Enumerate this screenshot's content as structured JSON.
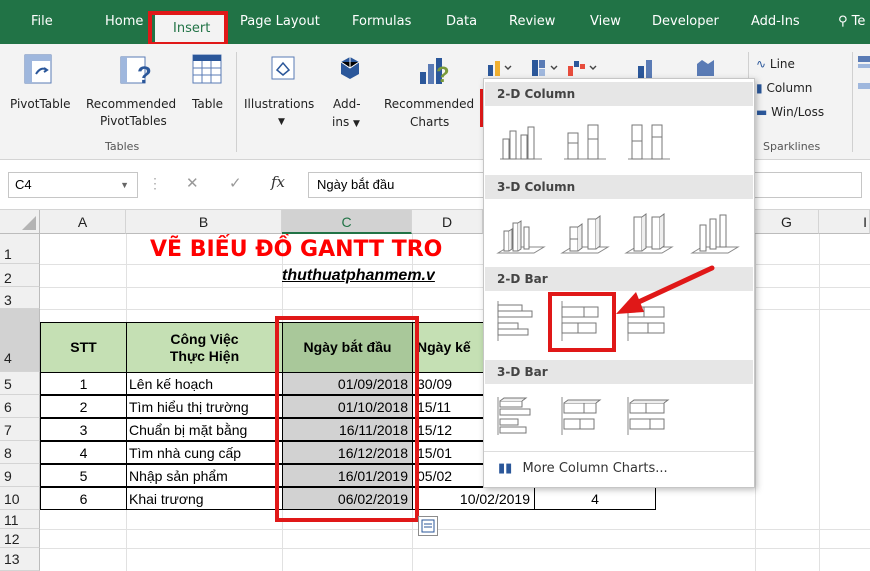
{
  "ribbon": {
    "tabs": [
      {
        "label": "File"
      },
      {
        "label": "Home"
      },
      {
        "label": "Insert"
      },
      {
        "label": "Page Layout"
      },
      {
        "label": "Formulas"
      },
      {
        "label": "Data"
      },
      {
        "label": "Review"
      },
      {
        "label": "View"
      },
      {
        "label": "Developer"
      },
      {
        "label": "Add-Ins"
      },
      {
        "label": "Te"
      }
    ],
    "groups": {
      "tables": {
        "label": "Tables",
        "pivottable": "PivotTable",
        "recommended_1": "Recommended",
        "recommended_2": "PivotTables",
        "table": "Table"
      },
      "illustrations": "Illustrations",
      "addins_1": "Add-",
      "addins_2": "ins",
      "rec_charts_1": "Recommended",
      "rec_charts_2": "Charts",
      "sparklines": {
        "label": "Sparklines",
        "line": "Line",
        "column": "Column",
        "winloss": "Win/Loss"
      }
    }
  },
  "formula_bar": {
    "cell_ref": "C4",
    "content": "Ngày bắt đầu"
  },
  "sheet": {
    "columns": [
      "A",
      "B",
      "C",
      "D",
      "G"
    ],
    "rows": [
      "1",
      "2",
      "3",
      "4",
      "5",
      "6",
      "7",
      "8",
      "9",
      "10",
      "11",
      "12",
      "13"
    ],
    "title": "VẼ BIỂU ĐỒ GANTT TRO",
    "subtitle": "thuthuatphanmem.v",
    "headers": {
      "stt": "STT",
      "task_1": "Công Việc",
      "task_2": "Thực Hiện",
      "start": "Ngày bắt đầu",
      "end": "Ngày kế"
    },
    "data": [
      {
        "stt": "1",
        "task": "Lên kế hoạch",
        "start": "01/09/2018",
        "end": "30/09",
        "dur": ""
      },
      {
        "stt": "2",
        "task": "Tìm hiểu thị trường",
        "start": "01/10/2018",
        "end": "15/11",
        "dur": ""
      },
      {
        "stt": "3",
        "task": "Chuẩn bị mặt bằng",
        "start": "16/11/2018",
        "end": "15/12",
        "dur": ""
      },
      {
        "stt": "4",
        "task": "Tìm nhà cung cấp",
        "start": "16/12/2018",
        "end": "15/01",
        "dur": ""
      },
      {
        "stt": "5",
        "task": "Nhập sản phẩm",
        "start": "16/01/2019",
        "end": "05/02",
        "dur": ""
      },
      {
        "stt": "6",
        "task": "Khai trương",
        "start": "06/02/2019",
        "end": "10/02/2019",
        "dur": "4"
      }
    ]
  },
  "dropdown": {
    "sections": {
      "col2d": "2-D Column",
      "col3d": "3-D Column",
      "bar2d": "2-D Bar",
      "bar3d": "3-D Bar"
    },
    "more": "More Column Charts..."
  },
  "colors": {
    "ribbon_green": "#217346",
    "highlight_red": "#e01818",
    "header_fill": "#c5e0b4",
    "title_red": "#ff0000"
  }
}
